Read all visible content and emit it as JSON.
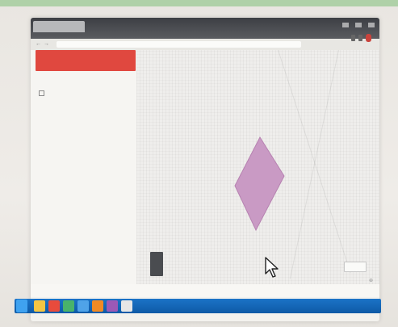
{
  "browser": {
    "tab_title": ""
  },
  "toolbar": {
    "back_icon": "back-arrow-icon",
    "forward_icon": "forward-arrow-icon",
    "url": ""
  },
  "left_panel": {
    "header_button": "",
    "section_label": "",
    "tree_item": "",
    "tree_item2": ""
  },
  "canvas": {
    "shape_fill": "#c99ac4",
    "shape_stroke": "#b782b1",
    "corner_num": "",
    "corner_label": "",
    "zoom_label": ""
  },
  "status": {
    "text": "",
    "bottom_label": ""
  },
  "taskbar": {
    "clock": "",
    "apps": [
      {
        "icon": "file-explorer-icon",
        "color": "#f4c542"
      },
      {
        "icon": "browser-icon",
        "color": "#e94b3c"
      },
      {
        "icon": "app-icon",
        "color": "#49b36b"
      },
      {
        "icon": "app-icon",
        "color": "#4fa3e8"
      },
      {
        "icon": "app-icon",
        "color": "#f08a24"
      },
      {
        "icon": "app-icon",
        "color": "#9b59b6"
      },
      {
        "icon": "app-icon",
        "color": "#e6e6e6"
      }
    ]
  },
  "colors": {
    "accent": "#e0483f",
    "taskbar": "#0e5aa6"
  }
}
